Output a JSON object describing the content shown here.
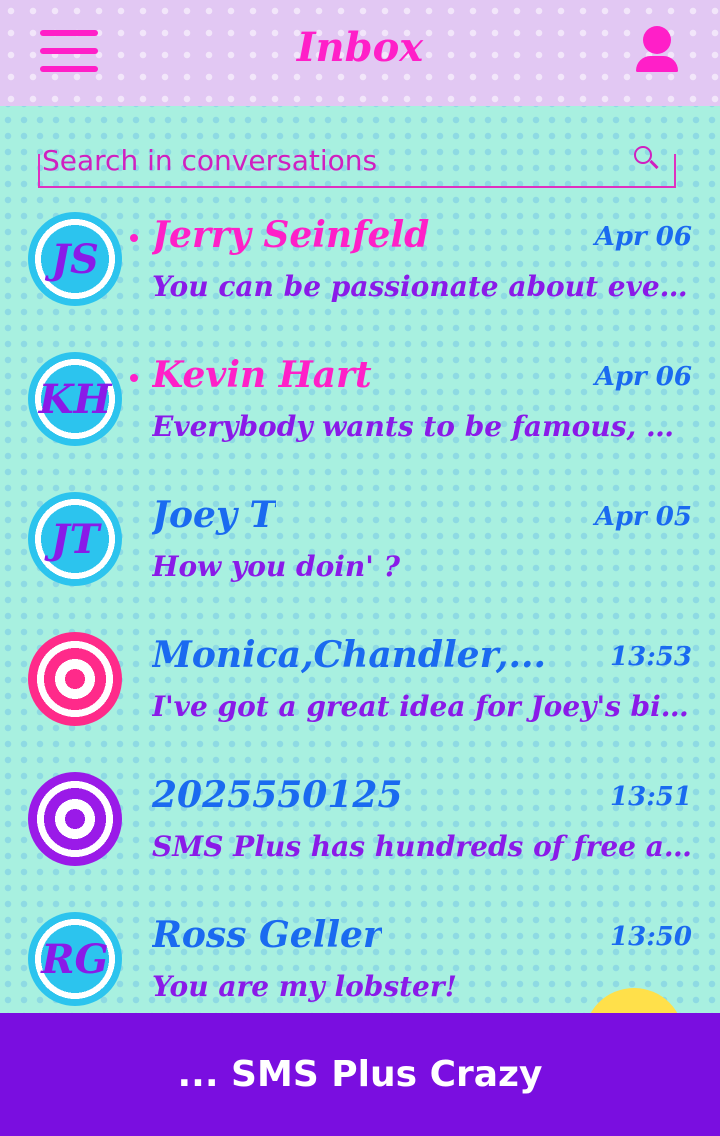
{
  "header": {
    "title": "Inbox",
    "menu_icon": "hamburger-menu-icon",
    "profile_icon": "person-icon"
  },
  "search": {
    "placeholder": "Search in conversations",
    "value": "",
    "icon": "search-icon"
  },
  "conversations": [
    {
      "avatar_type": "initials",
      "initials": "JS",
      "name": "Jerry Seinfeld",
      "time": "Apr 06",
      "preview": "You can be passionate about ever...",
      "unread": true
    },
    {
      "avatar_type": "initials",
      "initials": "KH",
      "name": "Kevin Hart",
      "time": "Apr 06",
      "preview": "Everybody wants to be famous, b...",
      "unread": true
    },
    {
      "avatar_type": "initials",
      "initials": "JT",
      "name": "Joey T",
      "time": "Apr 05",
      "preview": "How you doin' ?",
      "unread": false
    },
    {
      "avatar_type": "group-target-pink",
      "initials": "",
      "name": "Monica,Chandler,...",
      "time": "13:53",
      "preview": "I've got a great idea for Joey's bir...",
      "unread": false
    },
    {
      "avatar_type": "group-target-purple",
      "initials": "",
      "name": "2025550125",
      "time": "13:51",
      "preview": "SMS Plus has hundreds of free aw...",
      "unread": false
    },
    {
      "avatar_type": "initials",
      "initials": "RG",
      "name": "Ross Geller",
      "time": "13:50",
      "preview": "You are my lobster!",
      "unread": false
    }
  ],
  "banner": {
    "text": "... SMS Plus Crazy"
  },
  "colors": {
    "accent_pink": "#ff1fc8",
    "name_blue": "#1a6af0",
    "preview_purple": "#8a1ae8",
    "banner_purple": "#7a0ee0",
    "avatar_cyan": "#2cc4ee"
  }
}
